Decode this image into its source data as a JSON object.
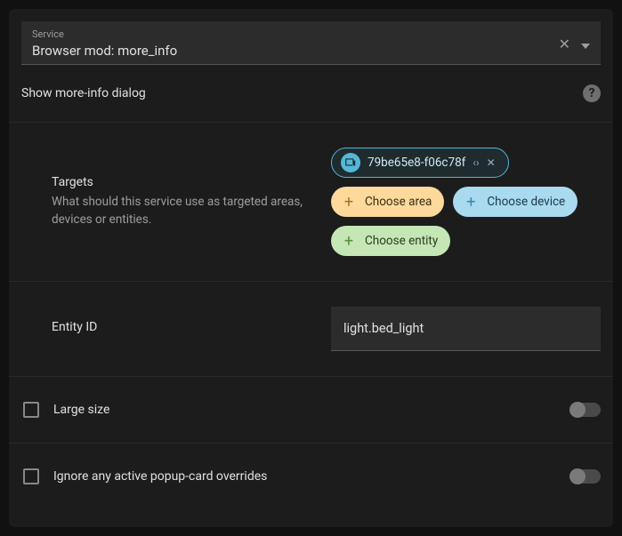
{
  "service": {
    "label": "Service",
    "value": "Browser mod: more_info"
  },
  "description": "Show more-info dialog",
  "targets": {
    "title": "Targets",
    "desc": "What should this service use as targeted areas, devices or entities.",
    "selected_device": "79be65e8-f06c78f",
    "choose_area": "Choose area",
    "choose_device": "Choose device",
    "choose_entity": "Choose entity"
  },
  "entity": {
    "title": "Entity ID",
    "value": "light.bed_light"
  },
  "large": {
    "label": "Large size"
  },
  "ignore": {
    "label": "Ignore any active popup-card overrides"
  }
}
